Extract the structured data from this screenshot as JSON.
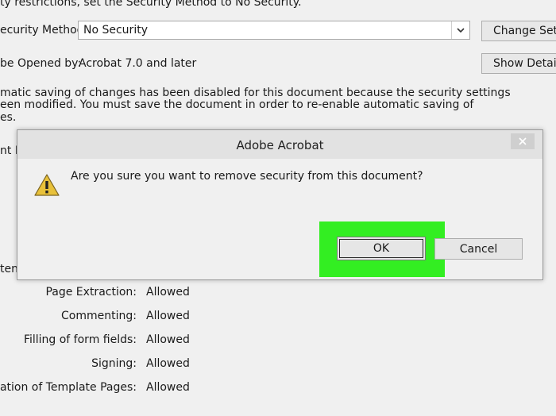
{
  "background": {
    "top_text": "ty restrictions, set the Security Method to No Security.",
    "security_method_label": "ecurity Method:",
    "security_method_value": "No Security",
    "change_settings_label": "Change Settin",
    "opened_by_label": "be Opened by:",
    "opened_by_value": "Acrobat 7.0 and later",
    "show_details_label": "Show Details",
    "notice_lines": [
      "matic saving of changes has been disabled for this document because the security settings",
      "een modified. You must save the document in order to re-enable automatic saving of",
      "es."
    ],
    "cut_label_1": "nt F",
    "cut_label_2": "ten",
    "permissions": [
      {
        "label": "Page Extraction:",
        "value": "Allowed"
      },
      {
        "label": "Commenting:",
        "value": "Allowed"
      },
      {
        "label": "Filling of form fields:",
        "value": "Allowed"
      },
      {
        "label": "Signing:",
        "value": "Allowed"
      },
      {
        "label": "Creation of Template Pages:",
        "value": "Allowed"
      }
    ]
  },
  "dialog": {
    "title": "Adobe Acrobat",
    "message": "Are you sure you want to remove security from this document?",
    "icon": "warning-icon",
    "ok_label": "OK",
    "cancel_label": "Cancel",
    "close_icon": "close-icon"
  },
  "colors": {
    "highlight": "#33ee22",
    "warning_fill": "#e8c13a"
  }
}
